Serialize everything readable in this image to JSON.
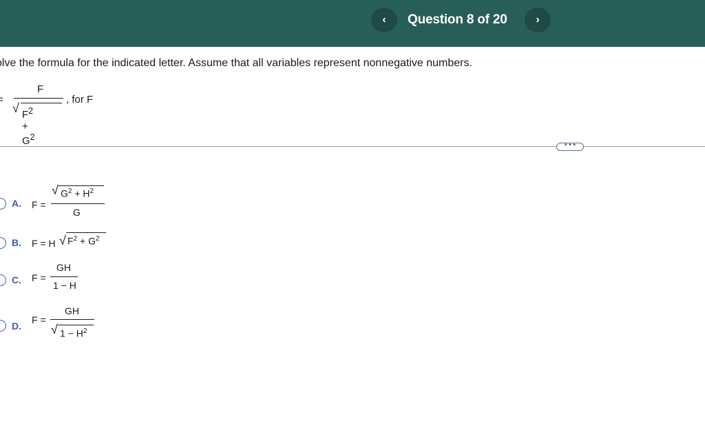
{
  "header": {
    "prev_label": "‹",
    "title": "Question 8 of 20",
    "next_label": "›"
  },
  "question": {
    "instruction": "olve the formula for the indicated letter. Assume that all variables represent nonnegative numbers.",
    "lhs": "=",
    "numerator": "F",
    "den_base": "F",
    "den_plus": "+ G",
    "suffix": ", for F",
    "exp": "2"
  },
  "more_label": "• • •",
  "options": [
    {
      "letter": "A.",
      "lhs": "F =",
      "num_a": "G",
      "num_plus": "+ H",
      "den": "G"
    },
    {
      "letter": "B.",
      "lhs": "F = H",
      "rad_a": "F",
      "rad_plus": "+ G"
    },
    {
      "letter": "C.",
      "lhs": "F =",
      "num": "GH",
      "den": "1 − H"
    },
    {
      "letter": "D.",
      "lhs": "F =",
      "num": "GH",
      "den_a": "1 − H"
    }
  ]
}
